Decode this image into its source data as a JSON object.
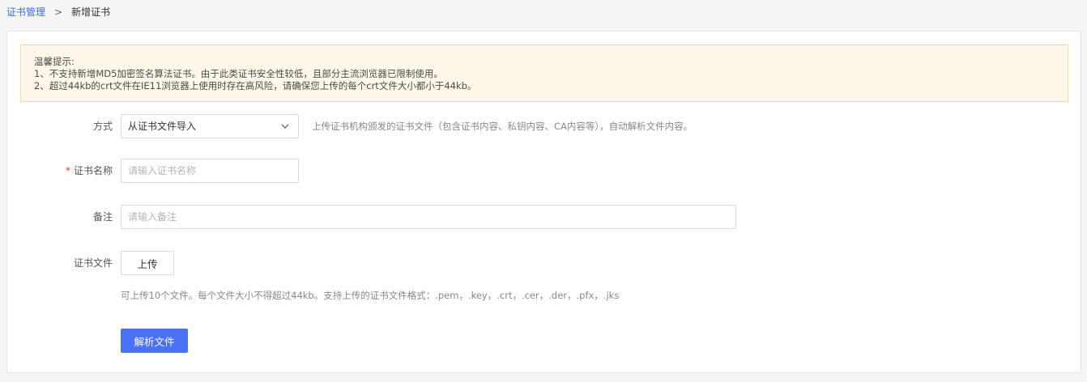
{
  "breadcrumb": {
    "parent": "证书管理",
    "separator": ">",
    "current": "新增证书"
  },
  "notice": {
    "title": "温馨提示:",
    "line1": "1、不支持新增MD5加密签名算法证书。由于此类证书安全性较低，且部分主流浏览器已限制使用。",
    "line2": "2、超过44kb的crt文件在IE11浏览器上使用时存在高风险，请确保您上传的每个crt文件大小都小于44kb。"
  },
  "form": {
    "method": {
      "label": "方式",
      "selected": "从证书文件导入",
      "hint": "上传证书机构颁发的证书文件（包含证书内容、私钥内容、CA内容等），自动解析文件内容。"
    },
    "name": {
      "required_mark": "*",
      "label": "证书名称",
      "placeholder": "请输入证书名称",
      "value": ""
    },
    "remark": {
      "label": "备注",
      "placeholder": "请输入备注",
      "value": ""
    },
    "file": {
      "label": "证书文件",
      "upload_label": "上传",
      "hint": "可上传10个文件。每个文件大小不得超过44kb。支持上传的证书文件格式：.pem，.key，.crt，.cer，.der，.pfx，.jks"
    },
    "parse_button": "解析文件"
  },
  "colors": {
    "primary": "#4a72f5",
    "link": "#3a6ee8",
    "notice_bg": "#fff8ea",
    "notice_border": "#f3d78f",
    "required": "#e0402b"
  },
  "icons": {
    "select_arrow": "chevron-down-icon"
  }
}
